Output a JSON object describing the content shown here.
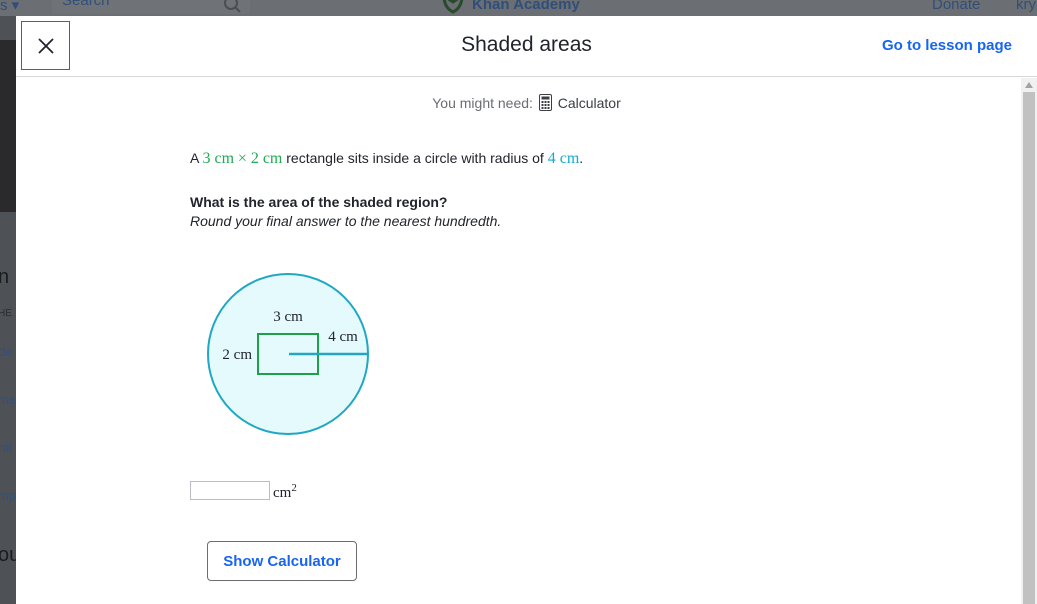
{
  "background": {
    "nav_left": "s ▾",
    "search_placeholder": "Search",
    "logo": "Khan Academy",
    "donate": "Donate",
    "user": "kry",
    "side_fragments": [
      "n",
      "HE",
      "de",
      "me",
      "nti",
      "mp",
      "ou"
    ]
  },
  "modal": {
    "title": "Shaded areas",
    "lesson_link": "Go to lesson page"
  },
  "needs": {
    "prefix": "You might need:",
    "tool": "Calculator"
  },
  "problem": {
    "lead": "A",
    "rect_w": "3 cm",
    "times": "×",
    "rect_h": "2 cm",
    "middle": "rectangle sits inside a circle with radius of",
    "radius": "4 cm",
    "end": "."
  },
  "question": "What is the area of the shaded region?",
  "hint": "Round your final answer to the nearest hundredth.",
  "figure": {
    "width_label": "3 cm",
    "height_label": "2 cm",
    "radius_label": "4 cm",
    "colors": {
      "circle_fill": "#e4fafc",
      "circle_stroke": "#20a8c2",
      "rect_stroke": "#1f9e4c"
    }
  },
  "answer": {
    "value": "",
    "unit": "cm",
    "unit_exp": "2"
  },
  "show_calculator_label": "Show Calculator",
  "colors": {
    "accent": "#1865f2",
    "green": "#1fab54",
    "teal": "#11accd"
  }
}
